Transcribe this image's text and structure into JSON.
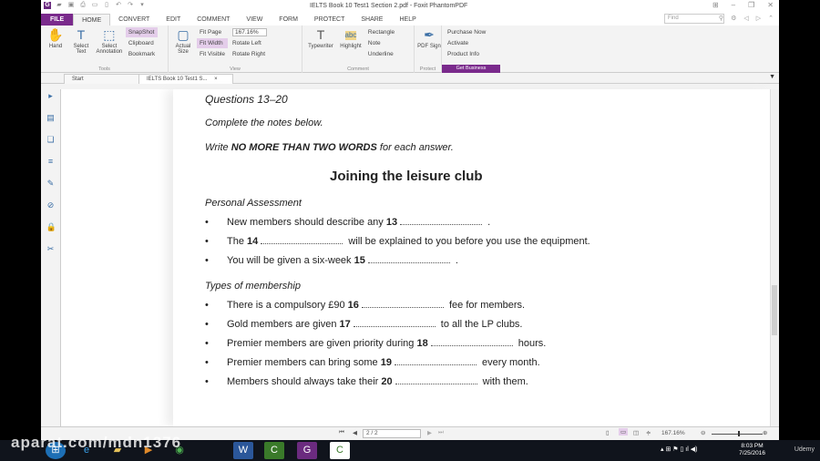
{
  "window": {
    "title": "IELTS Book 10 Test1 Section 2.pdf - Foxit PhantomPDF"
  },
  "menu": [
    "FILE",
    "HOME",
    "CONVERT",
    "EDIT",
    "COMMENT",
    "VIEW",
    "FORM",
    "PROTECT",
    "SHARE",
    "HELP"
  ],
  "find_placeholder": "Find",
  "ribbon": {
    "tools": {
      "label": "Tools",
      "hand": "Hand",
      "select_text": "Select Text",
      "select_annotation": "Select Annotation",
      "snapshot": "SnapShot",
      "clipboard": "Clipboard",
      "bookmark": "Bookmark"
    },
    "view": {
      "label": "View",
      "actual_size": "Actual Size",
      "fit_page": "Fit Page",
      "fit_width": "Fit Width",
      "fit_visible": "Fit Visible",
      "zoom": "167.16%",
      "rotate_left": "Rotate Left",
      "rotate_right": "Rotate Right"
    },
    "comment": {
      "label": "Comment",
      "typewriter": "Typewriter",
      "highlight": "Highlight",
      "rectangle": "Rectangle",
      "note": "Note",
      "underline": "Underline"
    },
    "protect": {
      "label": "Protect",
      "pdf_sign": "PDF Sign"
    },
    "business": {
      "purchase": "Purchase Now",
      "activate": "Activate",
      "product_info": "Product Info",
      "get_business": "Get Business"
    }
  },
  "tabs": [
    {
      "label": "Start"
    },
    {
      "label": "IELTS Book 10 Test1 S..."
    }
  ],
  "doc": {
    "heading": "Questions 13–20",
    "instr1": "Complete the notes below.",
    "instr2_pre": "Write ",
    "instr2_bold": "NO MORE THAN TWO WORDS",
    "instr2_post": " for each answer.",
    "title": "Joining the leisure club",
    "section1": "Personal Assessment",
    "items1": [
      {
        "pre": "New members should describe any ",
        "num": "13",
        "post": " ."
      },
      {
        "pre": "The ",
        "num": "14",
        "post": " will be explained to you before you use the equipment."
      },
      {
        "pre": "You will be given a six-week ",
        "num": "15",
        "post": " ."
      }
    ],
    "section2": "Types of membership",
    "items2": [
      {
        "pre": "There is a compulsory £90 ",
        "num": "16",
        "post": " fee for members."
      },
      {
        "pre": "Gold members are given ",
        "num": "17",
        "post": " to all the LP clubs."
      },
      {
        "pre": "Premier members are given priority during ",
        "num": "18",
        "post": " hours."
      },
      {
        "pre": "Premier members can bring some ",
        "num": "19",
        "post": " every month."
      },
      {
        "pre": "Members should always take their ",
        "num": "20",
        "post": " with them."
      }
    ]
  },
  "status": {
    "page": "2 / 2",
    "zoom": "167.16%"
  },
  "taskbar": {
    "time": "8:03 PM",
    "date": "7/25/2016",
    "udemy": "Udemy"
  },
  "watermark": "aparat.com/mdn1376"
}
